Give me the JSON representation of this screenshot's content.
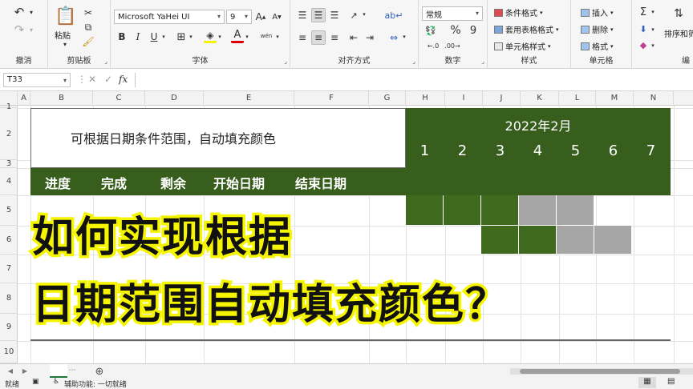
{
  "ribbon": {
    "undo_group": "撤消",
    "clipboard": {
      "paste": "粘贴",
      "group": "剪贴板"
    },
    "font": {
      "name": "Microsoft YaHei UI",
      "size": "9",
      "group": "字体",
      "bold": "B",
      "italic": "I",
      "underline": "U",
      "font_color_glyph": "A",
      "phonetic_glyph": "wén"
    },
    "alignment": {
      "group": "对齐方式"
    },
    "number": {
      "format": "常规",
      "group": "数字",
      "percent": "%",
      "comma": "9"
    },
    "styles": {
      "conditional": "条件格式",
      "table": "套用表格格式",
      "cell": "单元格样式",
      "group": "样式"
    },
    "cells": {
      "insert": "插入",
      "delete": "删除",
      "format": "格式",
      "group": "单元格"
    },
    "editing": {
      "sum": "Σ",
      "sort": "排序和筛",
      "group": "编"
    }
  },
  "formula_bar": {
    "name_box": "T33",
    "fx": "fx",
    "value": ""
  },
  "columns": [
    "A",
    "B",
    "C",
    "D",
    "E",
    "F",
    "G",
    "H",
    "I",
    "J",
    "K",
    "L",
    "M",
    "N"
  ],
  "rows": [
    "1",
    "2",
    "3",
    "4",
    "5",
    "6",
    "7",
    "8",
    "9",
    "10"
  ],
  "sheet": {
    "title": "可根据日期条件范围，自动填充颜色",
    "month": "2022年2月",
    "days": [
      "1",
      "2",
      "3",
      "4",
      "5",
      "6",
      "7"
    ],
    "headers": [
      "进度",
      "完成",
      "剩余",
      "开始日期",
      "结束日期"
    ]
  },
  "overlay": {
    "line1": "如何实现根据",
    "line2": "日期范围自动填充颜色？"
  },
  "status_bar": {
    "ready": "就绪",
    "accessibility": "辅助功能: 一切就绪"
  },
  "colors": {
    "green": "#3f6a1e",
    "header_green": "#375e1c",
    "gray": "#a6a6a6",
    "highlight": "#f5f500"
  }
}
